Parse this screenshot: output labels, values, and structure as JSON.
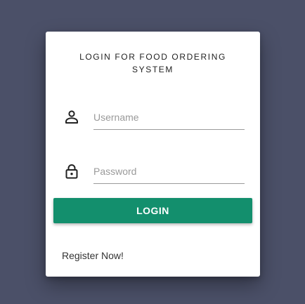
{
  "login_form": {
    "title": "LOGIN FOR FOOD ORDERING SYSTEM",
    "username": {
      "icon": "user-icon",
      "placeholder": "Username",
      "value": ""
    },
    "password": {
      "icon": "lock-icon",
      "placeholder": "Password",
      "value": ""
    },
    "login_button_label": "LOGIN",
    "register_link": "Register Now!"
  },
  "colors": {
    "background": "#4b5068",
    "card": "#ffffff",
    "accent": "#138f6d"
  }
}
